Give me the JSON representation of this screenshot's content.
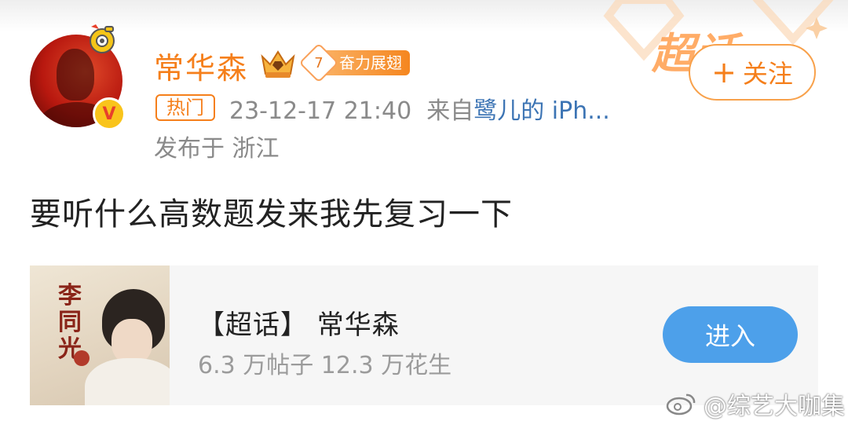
{
  "header": {
    "deco_text": "超话",
    "follow_label": "关注",
    "follow_plus": "+"
  },
  "user": {
    "name": "常华森",
    "level": "7",
    "level_title": "奋力展翅",
    "verify_mark": "V"
  },
  "post_meta": {
    "hot_tag": "热门",
    "time": "23-12-17 21:40",
    "from_prefix": "来自",
    "source": "鹭儿的 iPh...",
    "location": "发布于 浙江"
  },
  "post": {
    "text": "要听什么高数题发来我先复习一下"
  },
  "card": {
    "thumb_calligraphy": "李同光",
    "title": "【超话】 常华森",
    "stats": "6.3 万帖子  12.3 万花生",
    "enter_label": "进入"
  },
  "watermark": {
    "text": "@综艺大咖集"
  },
  "colors": {
    "accent_orange": "#f57f1b",
    "link_blue": "#3c74b4",
    "enter_blue": "#4da0ea"
  }
}
